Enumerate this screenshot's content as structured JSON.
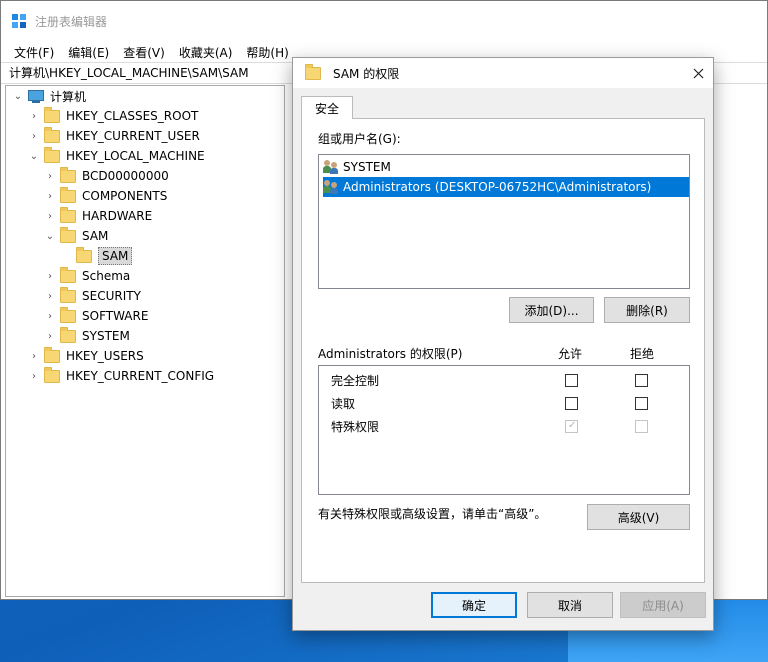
{
  "regedit": {
    "title": "注册表编辑器",
    "menu": [
      "文件(F)",
      "编辑(E)",
      "查看(V)",
      "收藏夹(A)",
      "帮助(H)"
    ],
    "address": "计算机\\HKEY_LOCAL_MACHINE\\SAM\\SAM",
    "tree": {
      "root": "计算机",
      "hives": [
        "HKEY_CLASSES_ROOT",
        "HKEY_CURRENT_USER",
        "HKEY_LOCAL_MACHINE",
        "HKEY_USERS",
        "HKEY_CURRENT_CONFIG"
      ],
      "hklm_children": [
        "BCD00000000",
        "COMPONENTS",
        "HARDWARE",
        "SAM",
        "Schema",
        "SECURITY",
        "SOFTWARE",
        "SYSTEM"
      ],
      "sam_child": "SAM"
    }
  },
  "dialog": {
    "title": "SAM 的权限",
    "tab": "安全",
    "group_label": "组或用户名(G):",
    "users": [
      "SYSTEM",
      "Administrators (DESKTOP-06752HC\\Administrators)"
    ],
    "add_button": "添加(D)...",
    "remove_button": "删除(R)",
    "perm_header": "Administrators 的权限(P)",
    "allow_col": "允许",
    "deny_col": "拒绝",
    "permissions": [
      {
        "name": "完全控制",
        "allow": false,
        "deny": false
      },
      {
        "name": "读取",
        "allow": false,
        "deny": false
      },
      {
        "name": "特殊权限",
        "allow": true,
        "deny": false
      }
    ],
    "advanced_text": "有关特殊权限或高级设置，请单击“高级”。",
    "advanced_button": "高级(V)",
    "ok_button": "确定",
    "cancel_button": "取消",
    "apply_button": "应用(A)"
  }
}
